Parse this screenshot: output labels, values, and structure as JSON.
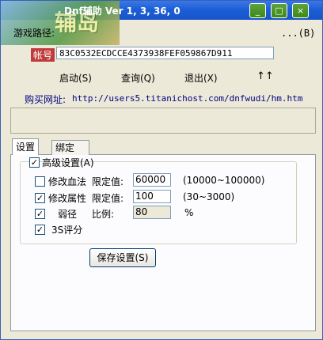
{
  "window": {
    "title": "Dnf辅助 Ver 1, 3, 36, 0",
    "logo_text": "辅岛"
  },
  "titlebar_buttons": {
    "minimize": "_",
    "maximize": "□",
    "close": "×"
  },
  "path": {
    "label": "游戏路径:",
    "browse_label": "...(B)",
    "value": ""
  },
  "account": {
    "label": "帐号",
    "value": "83C0532ECDCCE4373938FEF059867D911"
  },
  "actions": {
    "start": "启动(S)",
    "query": "查询(Q)",
    "exit": "退出(X)",
    "arrows": "↑↑"
  },
  "purchase": {
    "label": "购买网址:",
    "url": "http://users5.titanichost.com/dnfwudi/hm.htm"
  },
  "tabs": [
    {
      "label": "设置"
    },
    {
      "label": "绑定"
    }
  ],
  "advanced": {
    "label": "高级设置(A)",
    "checked": "✓",
    "rows": [
      {
        "check": "",
        "label": "修改血法",
        "sub_label": "限定值:",
        "value": "60000",
        "range": "(10000~100000)"
      },
      {
        "check": "✓",
        "label": "修改属性",
        "sub_label": "限定值:",
        "value": "100",
        "range": "(30~3000)"
      },
      {
        "check": "✓",
        "label": "弱径",
        "sub_label": "比例:",
        "value": "80",
        "range": "%"
      },
      {
        "check": "✓",
        "label": "3S评分"
      }
    ]
  },
  "save_button": "保存设置(S)"
}
